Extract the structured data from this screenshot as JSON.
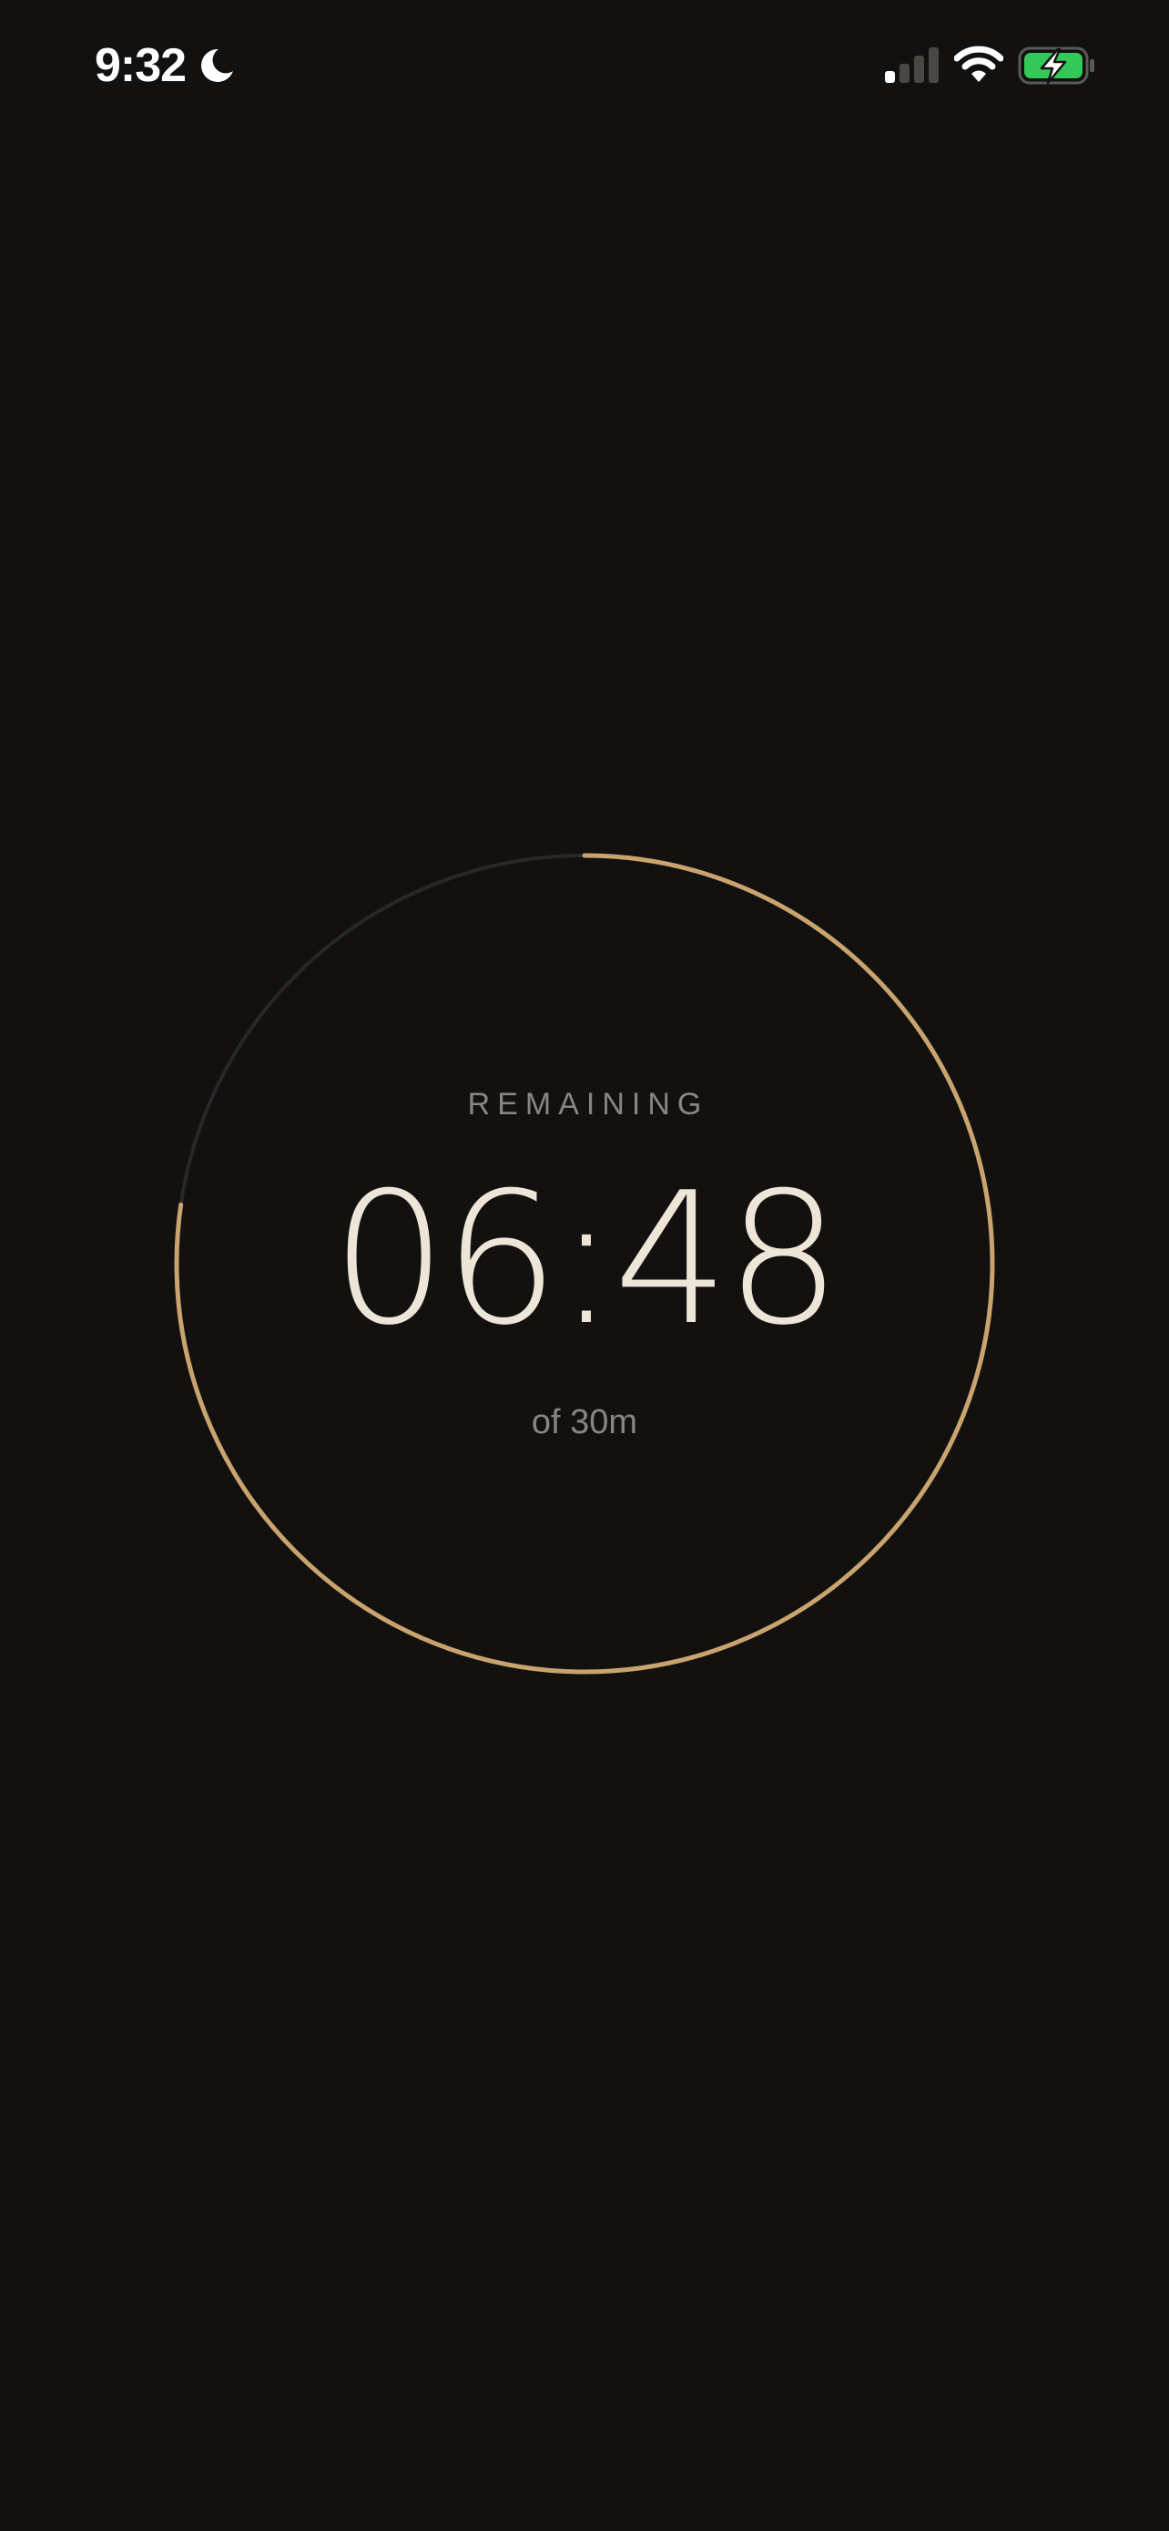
{
  "status_bar": {
    "time": "9:32",
    "focus_icon": "moon-icon",
    "signal_icon": "cellular-signal-icon",
    "signal_bars_active": 1,
    "signal_bars_total": 4,
    "wifi_icon": "wifi-icon",
    "battery_icon": "battery-charging-icon",
    "battery_color": "#34c759"
  },
  "timer": {
    "label": "REMAINING",
    "remaining": "06:48",
    "total": "of 30m",
    "progress_fraction": 0.773,
    "accent_color": "#c9a46f",
    "track_color": "#2a2826"
  }
}
